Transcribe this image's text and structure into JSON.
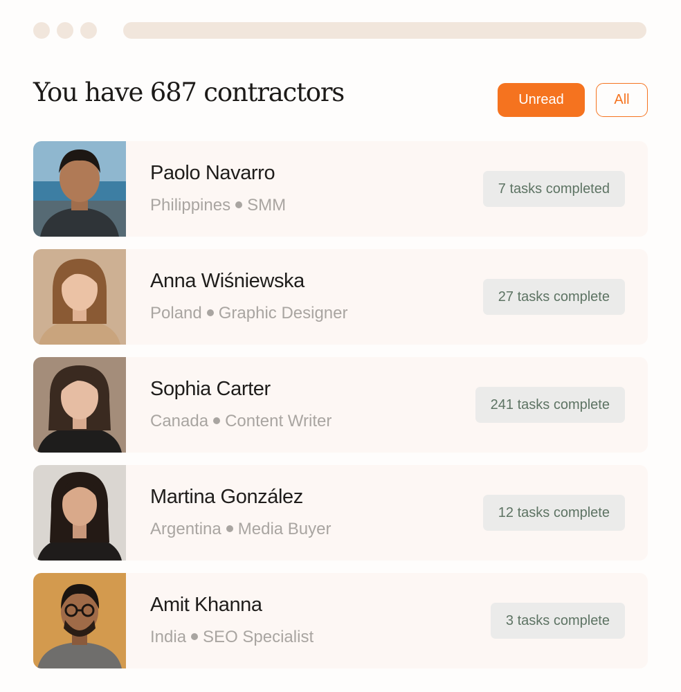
{
  "header": {
    "title": "You have 687 contractors",
    "filters": {
      "unread_label": "Unread",
      "all_label": "All",
      "active": "Unread"
    }
  },
  "colors": {
    "accent": "#f5731f",
    "badge_text": "#5d7363",
    "row_bg": "#fdf7f4"
  },
  "contractors": [
    {
      "name": "Paolo Navarro",
      "country": "Philippines",
      "role": "SMM",
      "tasks": "7 tasks completed",
      "photo_icon": "avatar-photo"
    },
    {
      "name": "Anna Wiśniewska",
      "country": "Poland",
      "role": "Graphic Designer",
      "tasks": "27 tasks complete",
      "photo_icon": "avatar-photo"
    },
    {
      "name": "Sophia Carter",
      "country": "Canada",
      "role": "Content Writer",
      "tasks": "241 tasks complete",
      "photo_icon": "avatar-photo"
    },
    {
      "name": "Martina González",
      "country": "Argentina",
      "role": "Media Buyer",
      "tasks": "12 tasks complete",
      "photo_icon": "avatar-photo"
    },
    {
      "name": "Amit Khanna",
      "country": "India",
      "role": "SEO Specialist",
      "tasks": "3 tasks complete",
      "photo_icon": "avatar-photo"
    }
  ]
}
